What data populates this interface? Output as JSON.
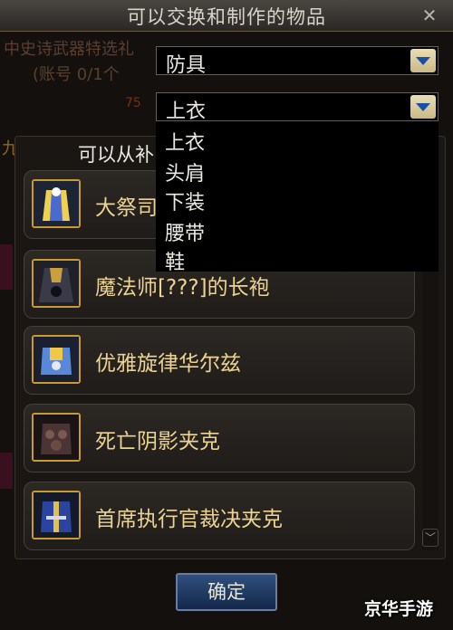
{
  "window": {
    "title": "可以交换和制作的物品"
  },
  "background": {
    "line1": "中史诗武器特选礼",
    "line2": "(账号 0/1个",
    "number": "75",
    "side": "九陆功"
  },
  "category_select": {
    "value": "防具"
  },
  "subcategory_select": {
    "value": "上衣",
    "options": [
      "上衣",
      "头肩",
      "下装",
      "腰带",
      "鞋"
    ]
  },
  "list": {
    "header": "可以从补",
    "items": [
      {
        "label": "大祭司",
        "icon": "robe-armor-icon"
      },
      {
        "label": "魔法师[???]的长袍",
        "icon": "dark-robe-icon"
      },
      {
        "label": "优雅旋律华尔兹",
        "icon": "plate-armor-icon"
      },
      {
        "label": "死亡阴影夹克",
        "icon": "dark-jacket-icon"
      },
      {
        "label": "首席执行官裁决夹克",
        "icon": "blue-jacket-icon"
      }
    ]
  },
  "confirm_label": "确定",
  "watermark": "京华手游",
  "colors": {
    "item_text": "#ecd392",
    "icon_border": "#c89a30",
    "button": "#13284a"
  }
}
